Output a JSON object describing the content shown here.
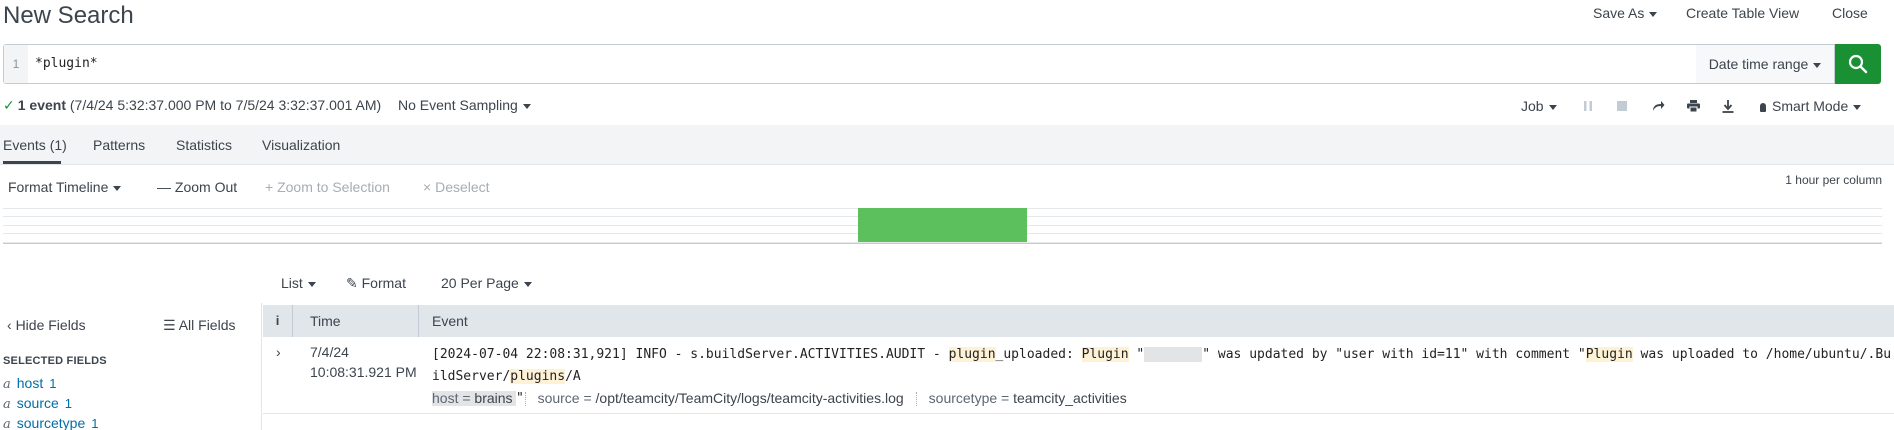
{
  "header": {
    "title": "New Search",
    "save_as": "Save As",
    "create_table_view": "Create Table View",
    "close": "Close"
  },
  "search": {
    "line_number": "1",
    "query": "*plugin*",
    "date_range": "Date time range"
  },
  "status": {
    "event_count": "1 event",
    "range": "(7/4/24 5:32:37.000 PM to 7/5/24 3:32:37.001 AM)",
    "sampling": "No Event Sampling",
    "job": "Job",
    "mode": "Smart Mode"
  },
  "tabs": [
    {
      "label": "Events (1)"
    },
    {
      "label": "Patterns"
    },
    {
      "label": "Statistics"
    },
    {
      "label": "Visualization"
    }
  ],
  "timeline": {
    "format": "Format Timeline",
    "zoom_out": "Zoom Out",
    "zoom_selection": "Zoom to Selection",
    "deselect": "Deselect",
    "per_column": "1 hour per column"
  },
  "results_controls": {
    "list": "List",
    "format": "Format",
    "per_page": "20 Per Page"
  },
  "sidebar": {
    "hide_fields": "Hide Fields",
    "all_fields": "All Fields",
    "selected_heading": "SELECTED FIELDS",
    "fields": [
      {
        "type": "a",
        "name": "host",
        "count": "1"
      },
      {
        "type": "a",
        "name": "source",
        "count": "1"
      },
      {
        "type": "a",
        "name": "sourcetype",
        "count": "1"
      }
    ]
  },
  "table": {
    "col_info": "i",
    "col_time": "Time",
    "col_event": "Event",
    "rows": [
      {
        "date": "7/4/24",
        "time": "10:08:31.921 PM",
        "event_parts": {
          "p1": "[2024-07-04 22:08:31,921]   INFO - s.buildServer.ACTIVITIES.AUDIT - ",
          "hl1": "plugin",
          "p2": "_uploaded: ",
          "hl2": "Plugin",
          "p3": " \"",
          "p4": "\" was updated by \"user with id=11\" with comment \"",
          "hl3": "Plugin",
          "p5": " was uploaded to /home/ubuntu/.BuildServer/",
          "hl4": "plugins",
          "p6": "/A",
          "p7": "\""
        },
        "fields": {
          "host_key": "host =",
          "host_val": "brains",
          "source_key": "source =",
          "source_val": "/opt/teamcity/TeamCity/logs/teamcity-activities.log",
          "sourcetype_key": "sourcetype =",
          "sourcetype_val": "teamcity_activities"
        }
      }
    ]
  },
  "colors": {
    "accent_green": "#1a9035",
    "timeline_bar": "#5cc05c",
    "link_blue": "#006eaa",
    "highlight": "#fdf1d6"
  },
  "icons": [
    "search-icon",
    "check-icon",
    "pause-icon",
    "stop-icon",
    "share-icon",
    "print-icon",
    "download-icon",
    "pin-icon",
    "chevron-left-icon",
    "list-icon",
    "pencil-icon",
    "chevron-right-icon"
  ]
}
